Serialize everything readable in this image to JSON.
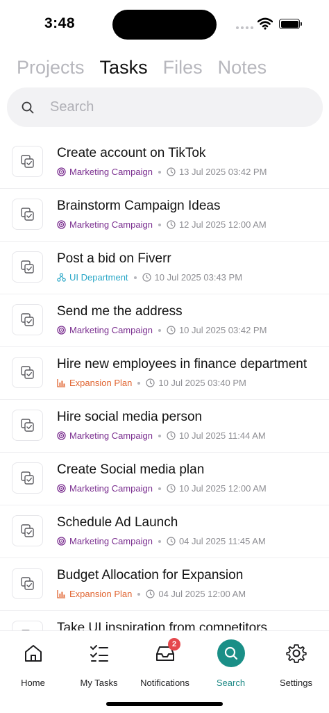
{
  "status_bar": {
    "time": "3:48"
  },
  "tabs": [
    {
      "label": "Projects",
      "active": false
    },
    {
      "label": "Tasks",
      "active": true
    },
    {
      "label": "Files",
      "active": false
    },
    {
      "label": "Notes",
      "active": false
    }
  ],
  "search": {
    "placeholder": "Search",
    "value": ""
  },
  "colors": {
    "marketing": "#7a2e8f",
    "ui_department": "#2aa7c7",
    "expansion": "#e0632f",
    "accent": "#1a8f87",
    "badge": "#e5484d"
  },
  "tasks": [
    {
      "title": "Create account on TikTok",
      "project": "Marketing Campaign",
      "project_icon": "target-icon",
      "date": "13 Jul 2025 03:42 PM"
    },
    {
      "title": "Brainstorm Campaign Ideas",
      "project": "Marketing Campaign",
      "project_icon": "target-icon",
      "date": "12 Jul 2025 12:00 AM"
    },
    {
      "title": "Post a bid on Fiverr",
      "project": "UI Department",
      "project_icon": "hierarchy-icon",
      "date": "10 Jul 2025 03:43 PM"
    },
    {
      "title": "Send me the address",
      "project": "Marketing Campaign",
      "project_icon": "target-icon",
      "date": "10 Jul 2025 03:42 PM"
    },
    {
      "title": "Hire new employees in finance department",
      "project": "Expansion Plan",
      "project_icon": "bar-chart-icon",
      "date": "10 Jul 2025 03:40 PM"
    },
    {
      "title": "Hire social media person",
      "project": "Marketing Campaign",
      "project_icon": "target-icon",
      "date": "10 Jul 2025 11:44 AM"
    },
    {
      "title": "Create Social media plan",
      "project": "Marketing Campaign",
      "project_icon": "target-icon",
      "date": "10 Jul 2025 12:00 AM"
    },
    {
      "title": "Schedule Ad Launch",
      "project": "Marketing Campaign",
      "project_icon": "target-icon",
      "date": "04 Jul 2025 11:45 AM"
    },
    {
      "title": "Budget Allocation for Expansion",
      "project": "Expansion Plan",
      "project_icon": "bar-chart-icon",
      "date": "04 Jul 2025 12:00 AM"
    },
    {
      "title": "Take UI inspiration from competitors",
      "project": "",
      "project_icon": "",
      "date": ""
    }
  ],
  "bottom_nav": [
    {
      "label": "Home",
      "icon": "home-icon",
      "active": false
    },
    {
      "label": "My Tasks",
      "icon": "checklist-icon",
      "active": false
    },
    {
      "label": "Notifications",
      "icon": "inbox-icon",
      "active": false,
      "badge": "2"
    },
    {
      "label": "Search",
      "icon": "search-icon",
      "active": true
    },
    {
      "label": "Settings",
      "icon": "gear-icon",
      "active": false
    }
  ]
}
